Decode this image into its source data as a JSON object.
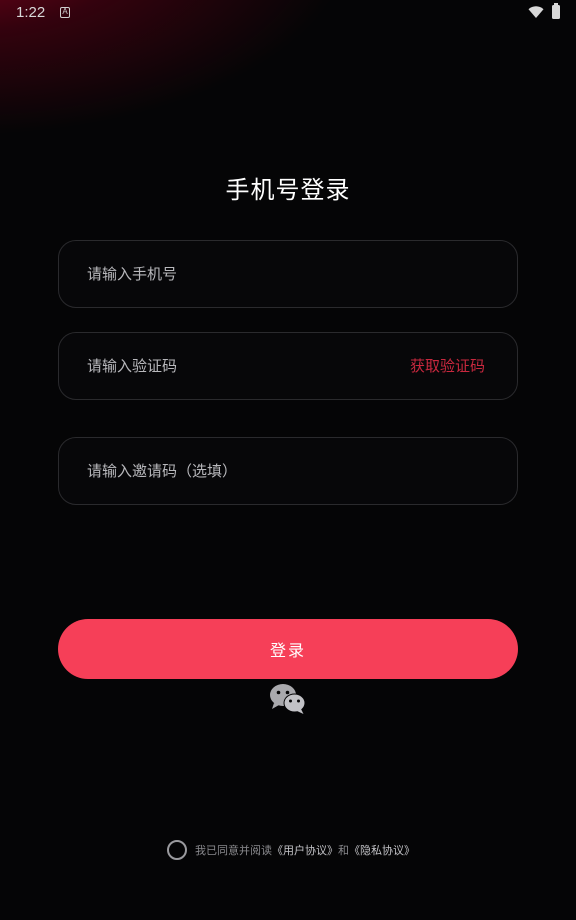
{
  "status_bar": {
    "time": "1:22",
    "notification_glyph": "A"
  },
  "page": {
    "title": "手机号登录"
  },
  "form": {
    "phone_placeholder": "请输入手机号",
    "code_placeholder": "请输入验证码",
    "get_code_label": "获取验证码",
    "invite_placeholder": "请输入邀请码（选填）",
    "login_label": "登录"
  },
  "agreement": {
    "prefix": "我已同意并阅读",
    "user_agreement": "《用户协议》",
    "connector": "和",
    "privacy_policy": "《隐私协议》"
  },
  "colors": {
    "accent": "#f63f58",
    "get_code": "#c8283e",
    "background": "#050506"
  },
  "icons": {
    "wechat": "wechat-icon",
    "wifi": "wifi-icon",
    "battery": "battery-icon"
  }
}
